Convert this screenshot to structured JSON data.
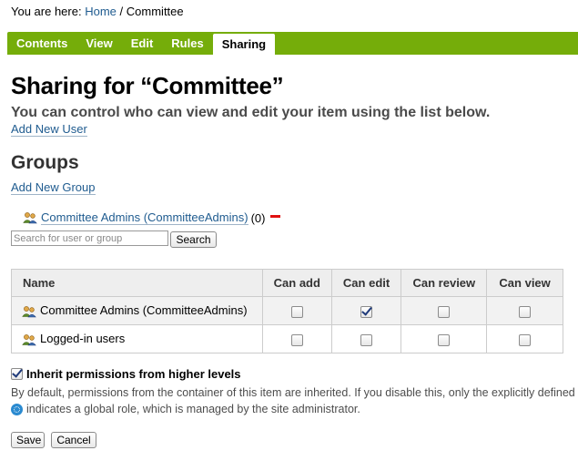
{
  "breadcrumb": {
    "prefix": "You are here:",
    "home": "Home",
    "separator": "/",
    "current": "Committee"
  },
  "tabs": [
    {
      "label": "Contents",
      "active": false
    },
    {
      "label": "View",
      "active": false
    },
    {
      "label": "Edit",
      "active": false
    },
    {
      "label": "Rules",
      "active": false
    },
    {
      "label": "Sharing",
      "active": true
    }
  ],
  "main": {
    "title": "Sharing for “Committee”",
    "description": "You can control who can view and edit your item using the list below.",
    "add_user": "Add New User",
    "groups_heading": "Groups",
    "add_group": "Add New Group",
    "group_entry": {
      "name": "Committee Admins (CommitteeAdmins)",
      "count": "(0)"
    },
    "search": {
      "placeholder": "Search for user or group",
      "value": "",
      "button": "Search"
    }
  },
  "table": {
    "headers": [
      "Name",
      "Can add",
      "Can edit",
      "Can review",
      "Can view"
    ],
    "rows": [
      {
        "name": "Committee Admins (CommitteeAdmins)",
        "can_add": false,
        "can_edit": true,
        "can_review": false,
        "can_view": false
      },
      {
        "name": "Logged-in users",
        "can_add": false,
        "can_edit": false,
        "can_review": false,
        "can_view": false
      }
    ]
  },
  "inherit": {
    "label": "Inherit permissions from higher levels",
    "checked": true,
    "help": "By default, permissions from the container of this item are inherited. If you disable this, only the explicitly defined",
    "global_role_note": "indicates a global role, which is managed by the site administrator."
  },
  "actions": {
    "save": "Save",
    "cancel": "Cancel"
  },
  "colors": {
    "tabbar": "#75ad0a",
    "link": "#205c90",
    "minus": "#e01010"
  }
}
